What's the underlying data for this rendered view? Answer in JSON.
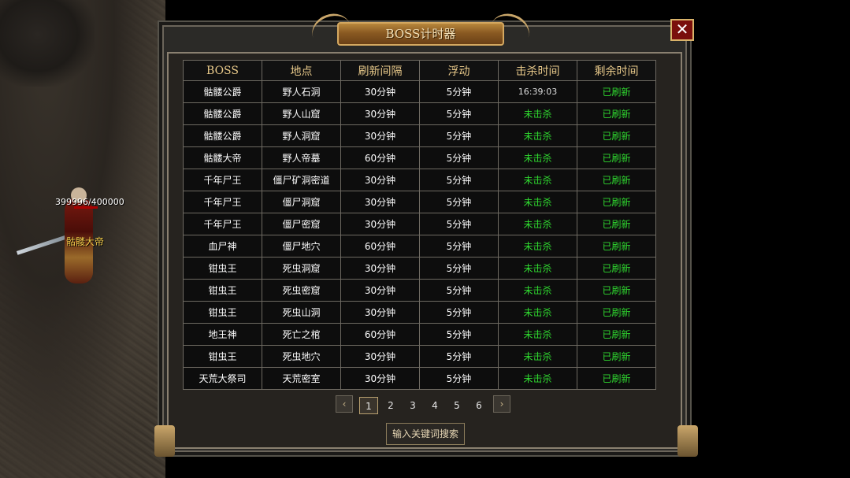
{
  "title": "BOSS计时器",
  "close_icon": "✕",
  "character": {
    "hp": "399996/400000",
    "name": "骷髅大帝"
  },
  "table": {
    "headers": [
      "BOSS",
      "地点",
      "刷新间隔",
      "浮动",
      "击杀时间",
      "剩余时间"
    ],
    "rows": [
      [
        "骷髅公爵",
        "野人石洞",
        "30分钟",
        "5分钟",
        "16:39:03",
        "已刷新"
      ],
      [
        "骷髅公爵",
        "野人山窟",
        "30分钟",
        "5分钟",
        "未击杀",
        "已刷新"
      ],
      [
        "骷髅公爵",
        "野人洞窟",
        "30分钟",
        "5分钟",
        "未击杀",
        "已刷新"
      ],
      [
        "骷髅大帝",
        "野人帝墓",
        "60分钟",
        "5分钟",
        "未击杀",
        "已刷新"
      ],
      [
        "千年尸王",
        "僵尸矿洞密道",
        "30分钟",
        "5分钟",
        "未击杀",
        "已刷新"
      ],
      [
        "千年尸王",
        "僵尸洞窟",
        "30分钟",
        "5分钟",
        "未击杀",
        "已刷新"
      ],
      [
        "千年尸王",
        "僵尸密窟",
        "30分钟",
        "5分钟",
        "未击杀",
        "已刷新"
      ],
      [
        "血尸神",
        "僵尸地穴",
        "60分钟",
        "5分钟",
        "未击杀",
        "已刷新"
      ],
      [
        "钳虫王",
        "死虫洞窟",
        "30分钟",
        "5分钟",
        "未击杀",
        "已刷新"
      ],
      [
        "钳虫王",
        "死虫密窟",
        "30分钟",
        "5分钟",
        "未击杀",
        "已刷新"
      ],
      [
        "钳虫王",
        "死虫山洞",
        "30分钟",
        "5分钟",
        "未击杀",
        "已刷新"
      ],
      [
        "地王神",
        "死亡之棺",
        "60分钟",
        "5分钟",
        "未击杀",
        "已刷新"
      ],
      [
        "钳虫王",
        "死虫地穴",
        "30分钟",
        "5分钟",
        "未击杀",
        "已刷新"
      ],
      [
        "天荒大祭司",
        "天荒密室",
        "30分钟",
        "5分钟",
        "未击杀",
        "已刷新"
      ]
    ]
  },
  "pagination": {
    "prev_icon": "‹",
    "next_icon": "›",
    "pages": [
      "1",
      "2",
      "3",
      "4",
      "5",
      "6"
    ],
    "current": "1"
  },
  "search_button": "输入关键词搜索",
  "colors": {
    "status_green": "#2fd72f",
    "header_gold": "#e8c98a",
    "title_plate": "#8a5a22",
    "close_red": "#7a0f0c"
  }
}
